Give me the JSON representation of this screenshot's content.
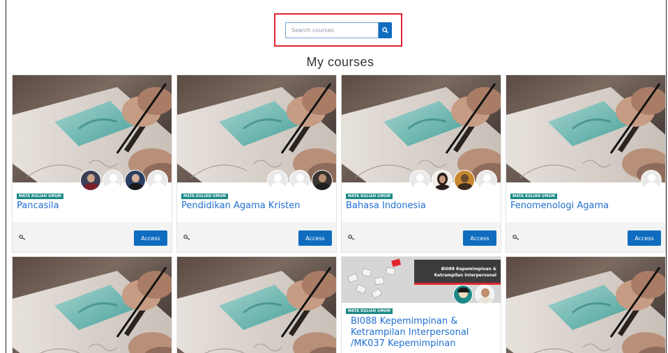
{
  "search": {
    "placeholder": "Search courses"
  },
  "heading": "My courses",
  "courses": [
    {
      "category": "MATA KULIAH UMUM",
      "title": "Pancasila",
      "access_label": "Access"
    },
    {
      "category": "MATA KULIAH UMUM",
      "title": "Pendidikan Agama Kristen",
      "access_label": "Access"
    },
    {
      "category": "MATA KULIAH UMUM",
      "title": "Bahasa Indonesia",
      "access_label": "Access"
    },
    {
      "category": "MATA KULIAH UMUM",
      "title": "Fenomenologi Agama",
      "access_label": "Access"
    }
  ],
  "row2": {
    "featured": {
      "banner_line1": "BI088 Kepemimpinan &",
      "banner_line2": "Ketrampilan Interpersonal",
      "category": "MATA KULIAH UMUM",
      "title_line1": "BI088 Kepemimpinan &",
      "title_line2": "Ketrampilan Interpersonal",
      "title_line3": "/MK037 Kepemimpinan"
    }
  },
  "colors": {
    "accent": "#0f6cbf",
    "badge": "#1d8a86",
    "link": "#1f6fd1",
    "highlight": "#e0242c"
  },
  "icons": {
    "search": "search-icon",
    "enrol": "key-icon"
  }
}
